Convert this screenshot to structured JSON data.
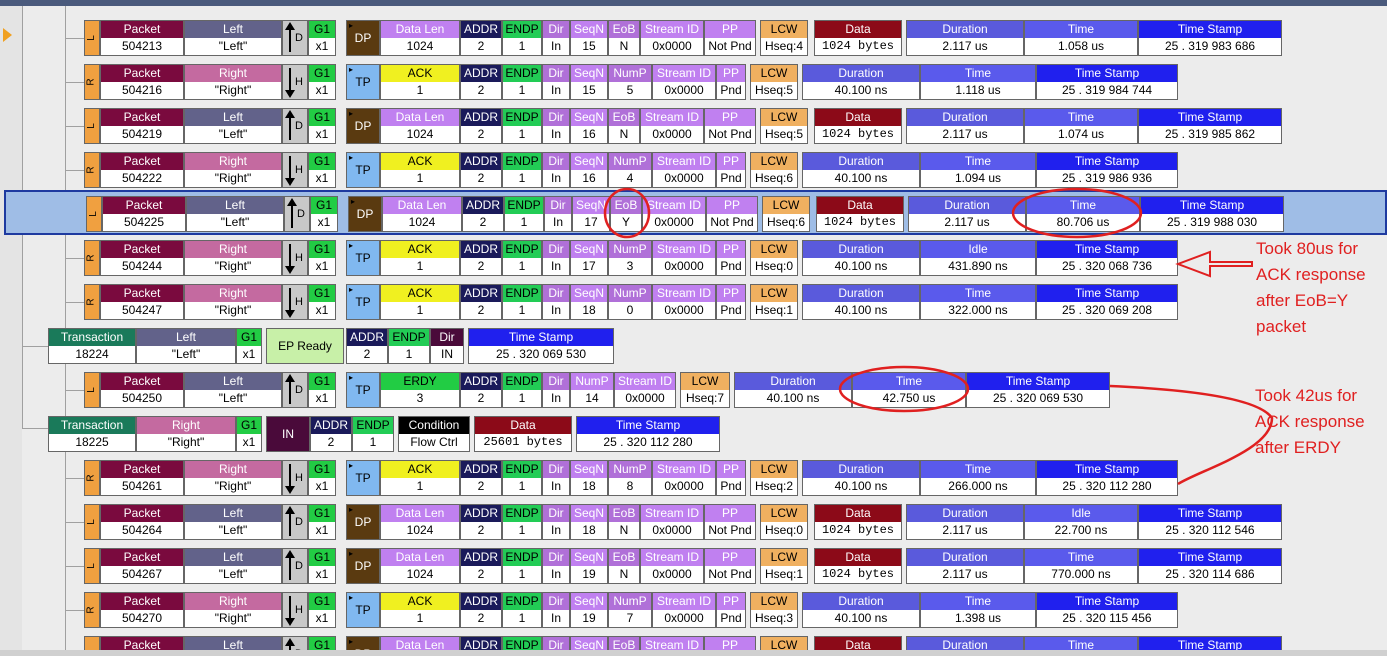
{
  "colors": {
    "packet": "#7a0a3e",
    "left": "#62628a",
    "right": "#c46aa0",
    "g1": "#22cc44",
    "dp": "#5a3a10",
    "tp": "#80b8f0",
    "datalen": "#c080f0",
    "addr": "#1a1a5a",
    "endp": "#22cc55",
    "dir": "#b070d8",
    "lcw": "#f0b060",
    "data": "#8c0a18",
    "duration": "#5a5adc",
    "time": "#5a5aec",
    "timestamp": "#2020ee",
    "ack": "#f0f020",
    "transaction": "#1a7a5a",
    "epready": "#c8f0a8",
    "in": "#4a0a3a",
    "cond": "#000000"
  },
  "headers": {
    "packet": "Packet",
    "left": "Left",
    "right": "Right",
    "g1": "G1",
    "x1": "x1",
    "dp": "DP",
    "tp": "TP",
    "datalen": "Data Len",
    "addr": "ADDR",
    "endp": "ENDP",
    "dir": "Dir",
    "seqn": "SeqN",
    "eob": "EoB",
    "numP": "NumP",
    "streamid": "Stream ID",
    "pp": "PP",
    "lcw": "LCW",
    "data": "Data",
    "duration": "Duration",
    "time": "Time",
    "idle": "Idle",
    "timestamp": "Time Stamp",
    "ack": "ACK",
    "erdy": "ERDY",
    "transaction": "Transaction",
    "epready": "EP Ready",
    "in": "IN",
    "condition": "Condition"
  },
  "rows": [
    {
      "kind": "dp",
      "side": "L",
      "packet": "504213",
      "dev": "\"Left\"",
      "dl": "1024",
      "addr": "2",
      "endp": "1",
      "dir": "In",
      "seqn": "15",
      "eob": "N",
      "sid": "0x0000",
      "pp": "Not Pnd",
      "lcw": "Hseq:4",
      "data": "1024 bytes",
      "dur": "2.117 us",
      "tlabel": "Time",
      "time": "1.058 us",
      "ts": "25 . 319 983 686"
    },
    {
      "kind": "tp",
      "side": "R",
      "packet": "504216",
      "dev": "\"Right\"",
      "mode": "ACK",
      "addr": "2",
      "endp": "1",
      "dir": "In",
      "seqn": "15",
      "nump": "5",
      "sid": "0x0000",
      "pp": "Pnd",
      "lcw": "Hseq:5",
      "dur": "40.100 ns",
      "tlabel": "Time",
      "time": "1.118 us",
      "ts": "25 . 319 984 744"
    },
    {
      "kind": "dp",
      "side": "L",
      "packet": "504219",
      "dev": "\"Left\"",
      "dl": "1024",
      "addr": "2",
      "endp": "1",
      "dir": "In",
      "seqn": "16",
      "eob": "N",
      "sid": "0x0000",
      "pp": "Not Pnd",
      "lcw": "Hseq:5",
      "data": "1024 bytes",
      "dur": "2.117 us",
      "tlabel": "Time",
      "time": "1.074 us",
      "ts": "25 . 319 985 862"
    },
    {
      "kind": "tp",
      "side": "R",
      "packet": "504222",
      "dev": "\"Right\"",
      "mode": "ACK",
      "addr": "2",
      "endp": "1",
      "dir": "In",
      "seqn": "16",
      "nump": "4",
      "sid": "0x0000",
      "pp": "Pnd",
      "lcw": "Hseq:6",
      "dur": "40.100 ns",
      "tlabel": "Time",
      "time": "1.094 us",
      "ts": "25 . 319 986 936"
    },
    {
      "kind": "dp",
      "side": "L",
      "sel": true,
      "packet": "504225",
      "dev": "\"Left\"",
      "dl": "1024",
      "addr": "2",
      "endp": "1",
      "dir": "In",
      "seqn": "17",
      "eob": "Y",
      "sid": "0x0000",
      "pp": "Not Pnd",
      "lcw": "Hseq:6",
      "data": "1024 bytes",
      "dur": "2.117 us",
      "tlabel": "Time",
      "time": "80.706 us",
      "ts": "25 . 319 988 030"
    },
    {
      "kind": "tp",
      "side": "R",
      "packet": "504244",
      "dev": "\"Right\"",
      "mode": "ACK",
      "addr": "2",
      "endp": "1",
      "dir": "In",
      "seqn": "17",
      "nump": "3",
      "sid": "0x0000",
      "pp": "Pnd",
      "lcw": "Hseq:0",
      "dur": "40.100 ns",
      "tlabel": "Idle",
      "time": "431.890 ns",
      "ts": "25 . 320 068 736"
    },
    {
      "kind": "tp",
      "side": "R",
      "packet": "504247",
      "dev": "\"Right\"",
      "mode": "ACK",
      "addr": "2",
      "endp": "1",
      "dir": "In",
      "seqn": "18",
      "nump": "0",
      "sid": "0x0000",
      "pp": "Pnd",
      "lcw": "Hseq:1",
      "dur": "40.100 ns",
      "tlabel": "Time",
      "time": "322.000 ns",
      "ts": "25 . 320 069 208"
    },
    {
      "kind": "trep",
      "trans": "18224",
      "dev": "\"Left\"",
      "addr": "2",
      "endp": "1",
      "dir": "IN",
      "ts": "25 . 320 069 530"
    },
    {
      "kind": "erdy",
      "side": "L",
      "packet": "504250",
      "dev": "\"Left\"",
      "mode": "ERDY",
      "modeval": "3",
      "addr": "2",
      "endp": "1",
      "dir": "In",
      "nump": "14",
      "sid": "0x0000",
      "lcw": "Hseq:7",
      "dur": "40.100 ns",
      "tlabel": "Time",
      "time": "42.750 us",
      "ts": "25 . 320 069 530"
    },
    {
      "kind": "trin",
      "trans": "18225",
      "dev": "\"Right\"",
      "addr": "2",
      "endp": "1",
      "cond": "Flow Ctrl",
      "data": "25601 bytes",
      "ts": "25 . 320 112 280"
    },
    {
      "kind": "tp",
      "side": "R",
      "packet": "504261",
      "dev": "\"Right\"",
      "mode": "ACK",
      "addr": "2",
      "endp": "1",
      "dir": "In",
      "seqn": "18",
      "nump": "8",
      "sid": "0x0000",
      "pp": "Pnd",
      "lcw": "Hseq:2",
      "dur": "40.100 ns",
      "tlabel": "Time",
      "time": "266.000 ns",
      "ts": "25 . 320 112 280"
    },
    {
      "kind": "dp",
      "side": "L",
      "packet": "504264",
      "dev": "\"Left\"",
      "dl": "1024",
      "addr": "2",
      "endp": "1",
      "dir": "In",
      "seqn": "18",
      "eob": "N",
      "sid": "0x0000",
      "pp": "Not Pnd",
      "lcw": "Hseq:0",
      "data": "1024 bytes",
      "dur": "2.117 us",
      "tlabel": "Idle",
      "time": "22.700 ns",
      "ts": "25 . 320 112 546"
    },
    {
      "kind": "dp",
      "side": "L",
      "packet": "504267",
      "dev": "\"Left\"",
      "dl": "1024",
      "addr": "2",
      "endp": "1",
      "dir": "In",
      "seqn": "19",
      "eob": "N",
      "sid": "0x0000",
      "pp": "Not Pnd",
      "lcw": "Hseq:1",
      "data": "1024 bytes",
      "dur": "2.117 us",
      "tlabel": "Time",
      "time": "770.000 ns",
      "ts": "25 . 320 114 686"
    },
    {
      "kind": "tp",
      "side": "R",
      "packet": "504270",
      "dev": "\"Right\"",
      "mode": "ACK",
      "addr": "2",
      "endp": "1",
      "dir": "In",
      "seqn": "19",
      "nump": "7",
      "sid": "0x0000",
      "pp": "Pnd",
      "lcw": "Hseq:3",
      "dur": "40.100 ns",
      "tlabel": "Time",
      "time": "1.398 us",
      "ts": "25 . 320 115 456"
    },
    {
      "kind": "dp",
      "side": "L",
      "partial": true,
      "packet": "",
      "dev": "",
      "dl": "",
      "addr": "",
      "endp": "",
      "dir": "",
      "seqn": "",
      "eob": "",
      "sid": "",
      "pp": "",
      "lcw": "",
      "data": "",
      "dur": "",
      "tlabel": "Time",
      "time": "",
      "ts": ""
    }
  ],
  "annotations": {
    "note1": [
      "Took 80us for",
      "ACK response",
      "after EoB=Y",
      "packet"
    ],
    "note2": [
      "Took 42us for",
      "ACK response",
      "after ERDY"
    ]
  }
}
